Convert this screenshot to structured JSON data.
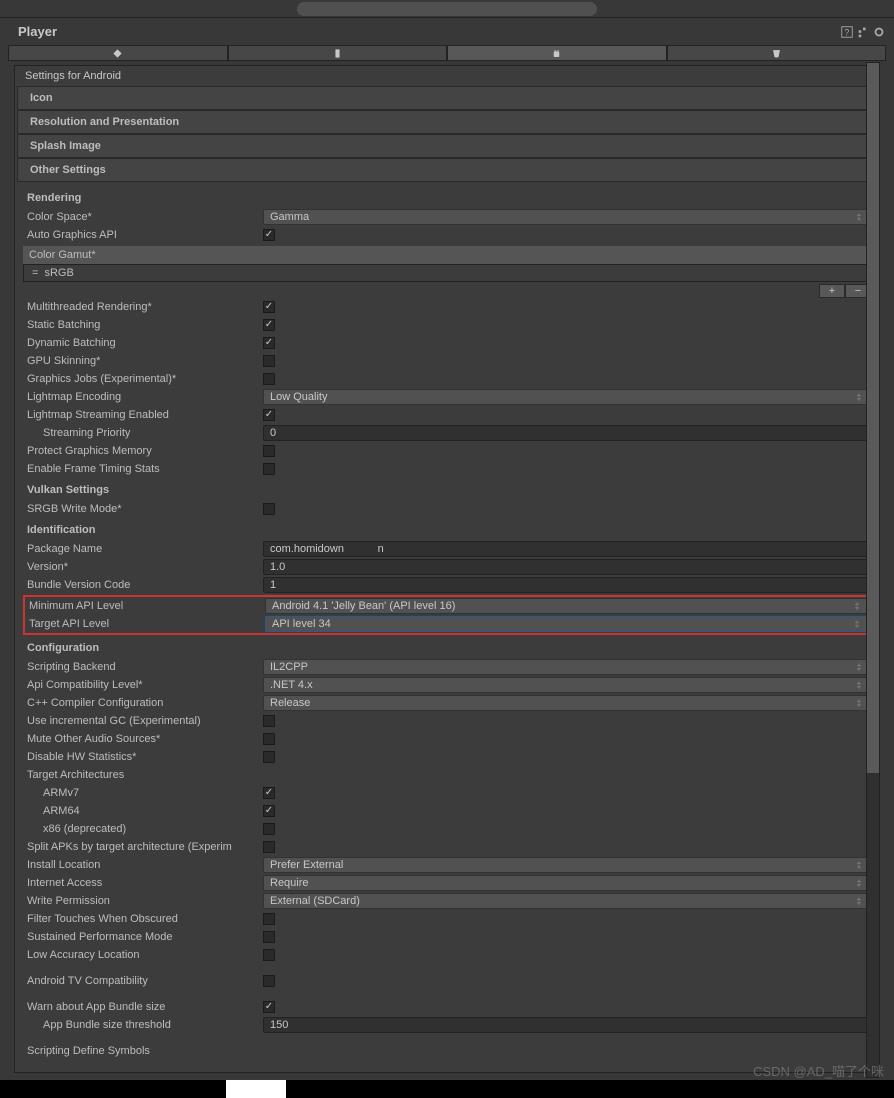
{
  "search": {
    "placeholder": ""
  },
  "header": {
    "title": "Player"
  },
  "settings_for": "Settings for Android",
  "sections": {
    "icon": "Icon",
    "resolution": "Resolution and Presentation",
    "splash": "Splash Image",
    "other": "Other Settings"
  },
  "rendering": {
    "title": "Rendering",
    "color_space": {
      "label": "Color Space*",
      "value": "Gamma"
    },
    "auto_graphics": {
      "label": "Auto Graphics API",
      "checked": true
    },
    "color_gamut": {
      "label": "Color Gamut*",
      "items": [
        "sRGB"
      ]
    },
    "multithreaded": {
      "label": "Multithreaded Rendering*",
      "checked": true
    },
    "static_batching": {
      "label": "Static Batching",
      "checked": true
    },
    "dynamic_batching": {
      "label": "Dynamic Batching",
      "checked": true
    },
    "gpu_skinning": {
      "label": "GPU Skinning*",
      "checked": false
    },
    "graphics_jobs": {
      "label": "Graphics Jobs (Experimental)*",
      "checked": false
    },
    "lightmap_encoding": {
      "label": "Lightmap Encoding",
      "value": "Low Quality"
    },
    "lightmap_streaming": {
      "label": "Lightmap Streaming Enabled",
      "checked": true
    },
    "streaming_priority": {
      "label": "Streaming Priority",
      "value": "0"
    },
    "protect_graphics": {
      "label": "Protect Graphics Memory",
      "checked": false
    },
    "frame_timing": {
      "label": "Enable Frame Timing Stats",
      "checked": false
    }
  },
  "vulkan": {
    "title": "Vulkan Settings",
    "srgb_write": {
      "label": "SRGB Write Mode*",
      "checked": false
    }
  },
  "identification": {
    "title": "Identification",
    "package_name": {
      "label": "Package Name",
      "value": "com.homidown           n"
    },
    "version": {
      "label": "Version*",
      "value": "1.0"
    },
    "bundle_code": {
      "label": "Bundle Version Code",
      "value": "1"
    },
    "min_api": {
      "label": "Minimum API Level",
      "value": "Android 4.1 'Jelly Bean' (API level 16)"
    },
    "target_api": {
      "label": "Target API Level",
      "value": "API level 34"
    }
  },
  "configuration": {
    "title": "Configuration",
    "scripting_backend": {
      "label": "Scripting Backend",
      "value": "IL2CPP"
    },
    "api_compat": {
      "label": "Api Compatibility Level*",
      "value": ".NET 4.x"
    },
    "cpp_compiler": {
      "label": "C++ Compiler Configuration",
      "value": "Release"
    },
    "incremental_gc": {
      "label": "Use incremental GC (Experimental)",
      "checked": false
    },
    "mute_audio": {
      "label": "Mute Other Audio Sources*",
      "checked": false
    },
    "disable_hw": {
      "label": "Disable HW Statistics*",
      "checked": false
    },
    "target_arch": {
      "label": "Target Architectures"
    },
    "armv7": {
      "label": "ARMv7",
      "checked": true
    },
    "arm64": {
      "label": "ARM64",
      "checked": true
    },
    "x86": {
      "label": "x86 (deprecated)",
      "checked": false
    },
    "split_apks": {
      "label": "Split APKs by target architecture (Experim",
      "checked": false
    },
    "install_location": {
      "label": "Install Location",
      "value": "Prefer External"
    },
    "internet_access": {
      "label": "Internet Access",
      "value": "Require"
    },
    "write_permission": {
      "label": "Write Permission",
      "value": "External (SDCard)"
    },
    "filter_touches": {
      "label": "Filter Touches When Obscured",
      "checked": false
    },
    "sustained_perf": {
      "label": "Sustained Performance Mode",
      "checked": false
    },
    "low_accuracy": {
      "label": "Low Accuracy Location",
      "checked": false
    },
    "android_tv": {
      "label": "Android TV Compatibility",
      "checked": false
    },
    "warn_bundle": {
      "label": "Warn about App Bundle size",
      "checked": true
    },
    "bundle_threshold": {
      "label": "App Bundle size threshold",
      "value": "150"
    },
    "scripting_define": {
      "label": "Scripting Define Symbols"
    }
  },
  "watermark": "CSDN @AD_喵了个咪"
}
